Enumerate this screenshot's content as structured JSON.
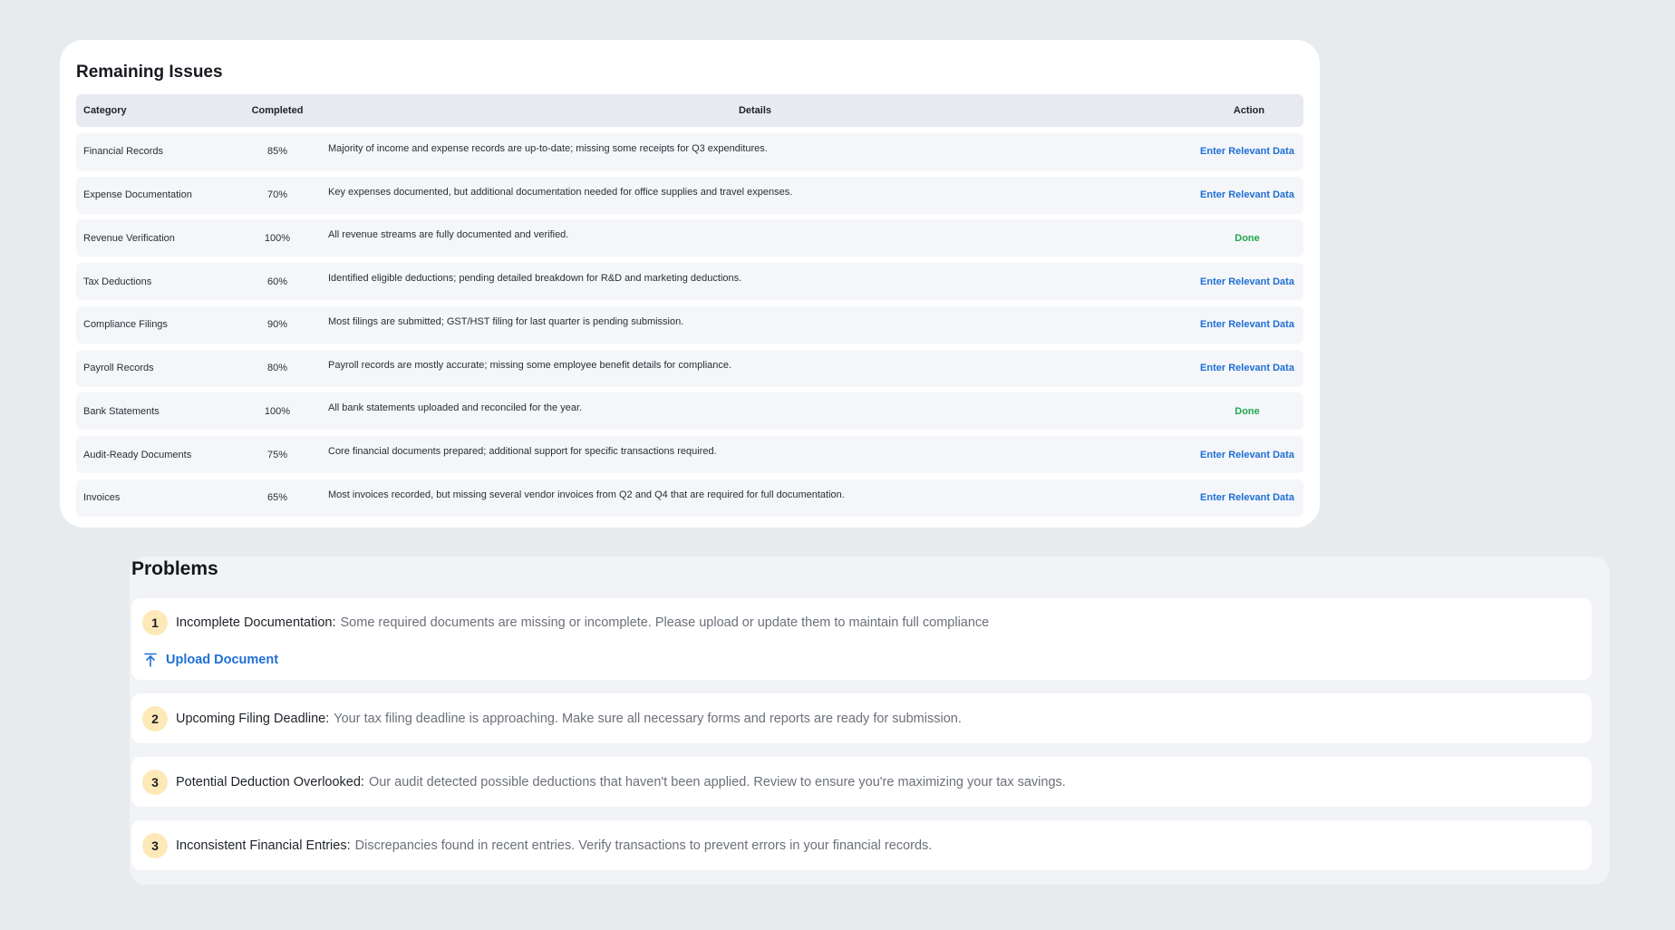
{
  "issues": {
    "title": "Remaining Issues",
    "headers": {
      "category": "Category",
      "completed": "Completed",
      "details": "Details",
      "action": "Action"
    },
    "rows": [
      {
        "category": "Financial Records",
        "completed": "85%",
        "details": "Majority of income and expense records are up-to-date; missing some receipts for Q3 expenditures.",
        "action": "Enter Relevant Data",
        "status": "link"
      },
      {
        "category": "Expense Documentation",
        "completed": "70%",
        "details": "Key expenses documented, but additional documentation needed for office supplies and travel expenses.",
        "action": "Enter Relevant Data",
        "status": "link"
      },
      {
        "category": "Revenue Verification",
        "completed": "100%",
        "details": "All revenue streams are fully documented and verified.",
        "action": "Done",
        "status": "done"
      },
      {
        "category": "Tax Deductions",
        "completed": "60%",
        "details": "Identified eligible deductions; pending detailed breakdown for R&D and marketing deductions.",
        "action": "Enter Relevant Data",
        "status": "link"
      },
      {
        "category": "Compliance Filings",
        "completed": "90%",
        "details": "Most filings are submitted; GST/HST filing for last quarter is pending submission.",
        "action": "Enter Relevant Data",
        "status": "link"
      },
      {
        "category": "Payroll Records",
        "completed": "80%",
        "details": "Payroll records are mostly accurate; missing some employee benefit details for compliance.",
        "action": "Enter Relevant Data",
        "status": "link"
      },
      {
        "category": "Bank Statements",
        "completed": "100%",
        "details": "All bank statements uploaded and reconciled for the year.",
        "action": "Done",
        "status": "done"
      },
      {
        "category": "Audit-Ready Documents",
        "completed": "75%",
        "details": "Core financial documents prepared; additional support for specific transactions required.",
        "action": "Enter Relevant Data",
        "status": "link"
      },
      {
        "category": "Invoices",
        "completed": "65%",
        "details": "Most invoices recorded, but missing several vendor invoices from Q2 and Q4 that are required for full documentation.",
        "action": "Enter Relevant Data",
        "status": "link"
      }
    ]
  },
  "problems": {
    "title": "Problems",
    "items": [
      {
        "number": "1",
        "label": "Incomplete Documentation:",
        "description": "Some required documents are missing or incomplete. Please upload or update them to maintain full compliance",
        "action": "Upload Document"
      },
      {
        "number": "2",
        "label": "Upcoming Filing Deadline:",
        "description": "Your tax filing deadline is approaching. Make sure all necessary forms and reports are ready for submission."
      },
      {
        "number": "3",
        "label": "Potential Deduction Overlooked:",
        "description": "Our audit detected possible deductions that haven't been applied. Review to ensure you're maximizing your tax savings."
      },
      {
        "number": "3",
        "label": "Inconsistent Financial Entries:",
        "description": "Discrepancies found in recent entries. Verify transactions to prevent errors in your financial records."
      }
    ]
  },
  "colors": {
    "link": "#1f6fd6",
    "done": "#1fa84e",
    "badge": "#fde9b8",
    "background": "#e8ebee"
  },
  "icons": {
    "upload": "upload-icon"
  }
}
